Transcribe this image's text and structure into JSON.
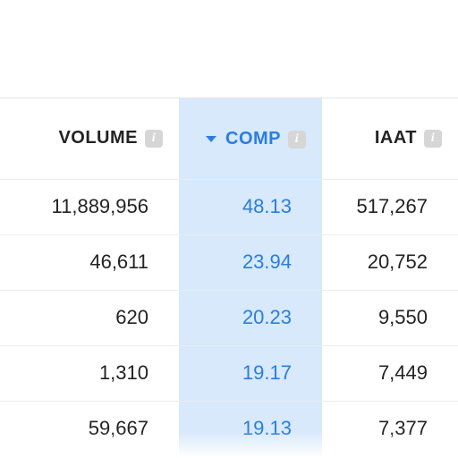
{
  "table": {
    "columns": {
      "volume": {
        "label": "VOLUME"
      },
      "comp": {
        "label": "COMP",
        "sorted": "desc"
      },
      "iaat": {
        "label": "IAAT"
      }
    },
    "rows": [
      {
        "volume": "11,889,956",
        "comp": "48.13",
        "iaat": "517,267"
      },
      {
        "volume": "46,611",
        "comp": "23.94",
        "iaat": "20,752"
      },
      {
        "volume": "620",
        "comp": "20.23",
        "iaat": "9,550"
      },
      {
        "volume": "1,310",
        "comp": "19.17",
        "iaat": "7,449"
      },
      {
        "volume": "59,667",
        "comp": "19.13",
        "iaat": "7,377"
      }
    ]
  }
}
